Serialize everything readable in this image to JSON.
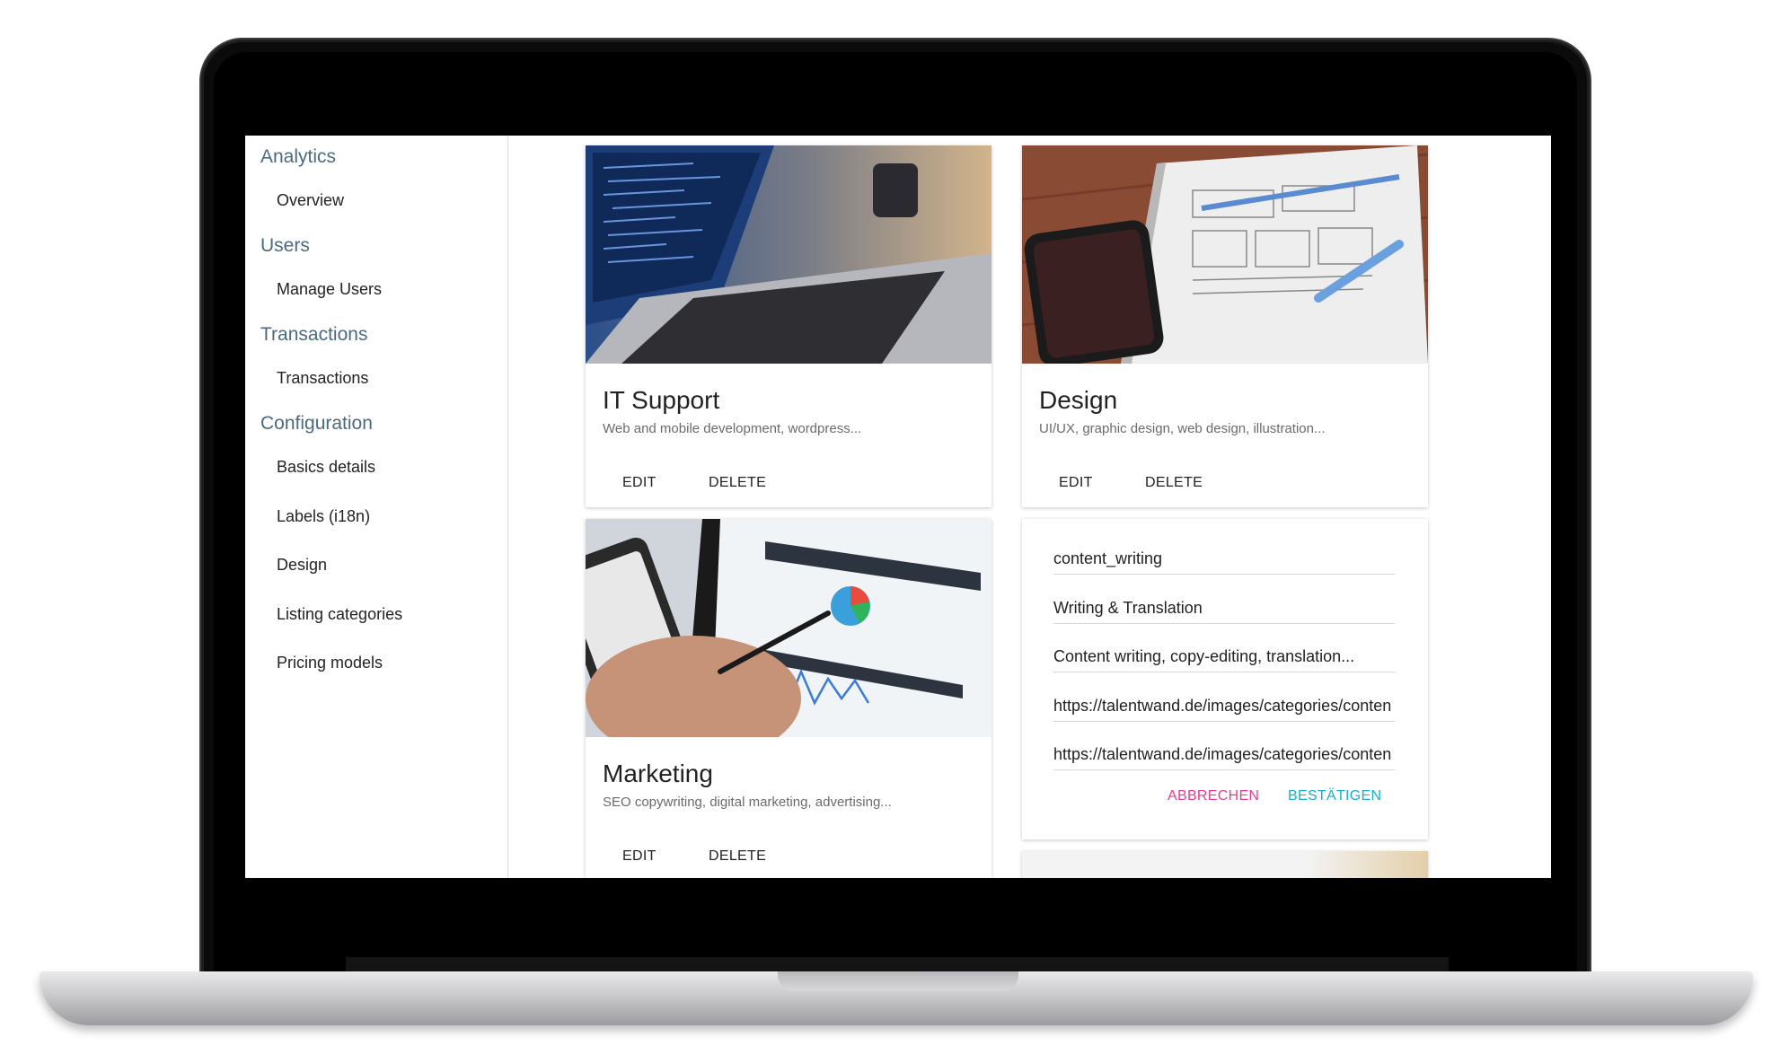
{
  "sidebar": {
    "sections": [
      {
        "title": "Analytics",
        "items": [
          "Overview"
        ]
      },
      {
        "title": "Users",
        "items": [
          "Manage Users"
        ]
      },
      {
        "title": "Transactions",
        "items": [
          "Transactions"
        ]
      },
      {
        "title": "Configuration",
        "items": [
          "Basics details",
          "Labels (i18n)",
          "Design",
          "Listing categories",
          "Pricing models"
        ]
      }
    ]
  },
  "cards": [
    {
      "title": "IT Support",
      "description": "Web and mobile development, wordpress...",
      "edit_label": "EDIT",
      "delete_label": "DELETE"
    },
    {
      "title": "Design",
      "description": "UI/UX, graphic design, web design, illustration...",
      "edit_label": "EDIT",
      "delete_label": "DELETE"
    },
    {
      "title": "Marketing",
      "description": "SEO copywriting, digital marketing, advertising...",
      "edit_label": "EDIT",
      "delete_label": "DELETE"
    }
  ],
  "edit_form": {
    "fields": [
      "content_writing",
      "Writing & Translation",
      "Content writing, copy-editing, translation...",
      "https://talentwand.de/images/categories/conten",
      "https://talentwand.de/images/categories/conten"
    ],
    "cancel_label": "ABBRECHEN",
    "confirm_label": "BESTÄTIGEN"
  },
  "colors": {
    "sidebar_section": "#4b6a80",
    "cancel": "#e83e8c",
    "confirm": "#1ab0c8"
  }
}
